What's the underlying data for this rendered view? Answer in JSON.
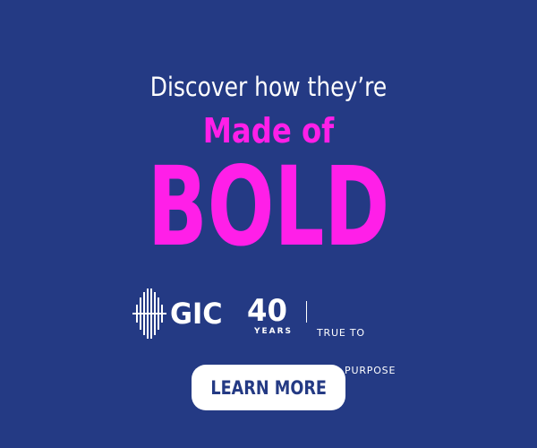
{
  "ad": {
    "intro": "Discover how they’re",
    "subhead": "Made of",
    "headline": "BOLD",
    "logo": {
      "brand": "GIC",
      "anniversary": "40",
      "anniversary_label": "YEARS",
      "tagline_line1": "TRUE TO",
      "tagline_line2": "OUR PURPOSE"
    },
    "cta_label": "LEARN MORE"
  },
  "colors": {
    "background": "#243a84",
    "accent": "#ff1fe8",
    "text": "#ffffff",
    "button_background": "#ffffff",
    "button_text": "#243a84"
  },
  "icons": {
    "logo_mark": "gic-logo-icon"
  }
}
